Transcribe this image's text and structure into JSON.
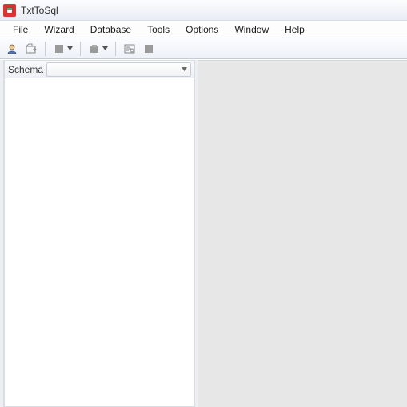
{
  "title": "TxtToSql",
  "menu": {
    "file": "File",
    "wizard": "Wizard",
    "database": "Database",
    "tools": "Tools",
    "options": "Options",
    "window": "Window",
    "help": "Help"
  },
  "toolbar": {
    "icons": {
      "session": "session-icon",
      "open": "open-icon",
      "import": "import-icon",
      "export": "export-icon",
      "query": "query-icon",
      "run": "run-icon"
    }
  },
  "sidebar": {
    "schema_label": "Schema",
    "schema_value": ""
  }
}
